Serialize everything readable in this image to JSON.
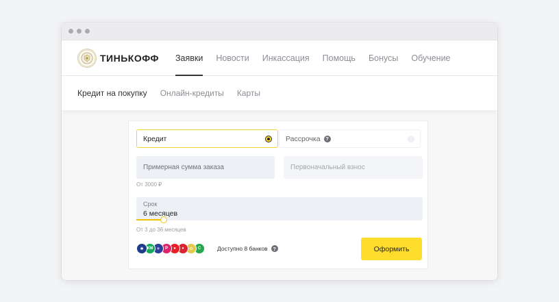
{
  "header": {
    "logo_text": "ТИНЬКОФФ",
    "nav": [
      {
        "label": "Заявки",
        "active": true
      },
      {
        "label": "Новости"
      },
      {
        "label": "Инкассация"
      },
      {
        "label": "Помощь"
      },
      {
        "label": "Бонусы"
      },
      {
        "label": "Обучение"
      }
    ]
  },
  "subnav": [
    {
      "label": "Кредит на покупку",
      "active": true
    },
    {
      "label": "Онлайн-кредиты"
    },
    {
      "label": "Карты"
    }
  ],
  "form": {
    "type_options": [
      {
        "label": "Кредит",
        "selected": true
      },
      {
        "label": "Рассрочка",
        "selected": false
      }
    ],
    "amount_placeholder": "Примерная сумма заказа",
    "amount_hint": "От 3000 ₽",
    "initial_placeholder": "Первоначальный взнос",
    "term_label": "Срок",
    "term_value": "6 месяцев",
    "term_hint": "От 3 до 36 месяцев",
    "term_slider_fraction": 0.0,
    "banks_text": "Доступно 8 банков",
    "submit_label": "Оформить"
  },
  "banks": [
    {
      "name": "bank-1-icon",
      "color": "#1f3c8c",
      "glyph": "✱"
    },
    {
      "name": "bank-2-icon",
      "color": "#14a85a",
      "glyph": "КМ"
    },
    {
      "name": "bank-3-icon",
      "color": "#2a3f9a",
      "glyph": "⚜"
    },
    {
      "name": "bank-4-icon",
      "color": "#e0246b",
      "glyph": "Р"
    },
    {
      "name": "bank-5-icon",
      "color": "#e8202a",
      "glyph": "●"
    },
    {
      "name": "bank-6-icon",
      "color": "#d9232e",
      "glyph": "♦"
    },
    {
      "name": "bank-7-icon",
      "color": "#e3c84e",
      "glyph": "⚙"
    },
    {
      "name": "bank-8-icon",
      "color": "#23a84b",
      "glyph": "С"
    }
  ],
  "colors": {
    "accent": "#ffdd2d",
    "field_bg": "#edf0f5"
  }
}
